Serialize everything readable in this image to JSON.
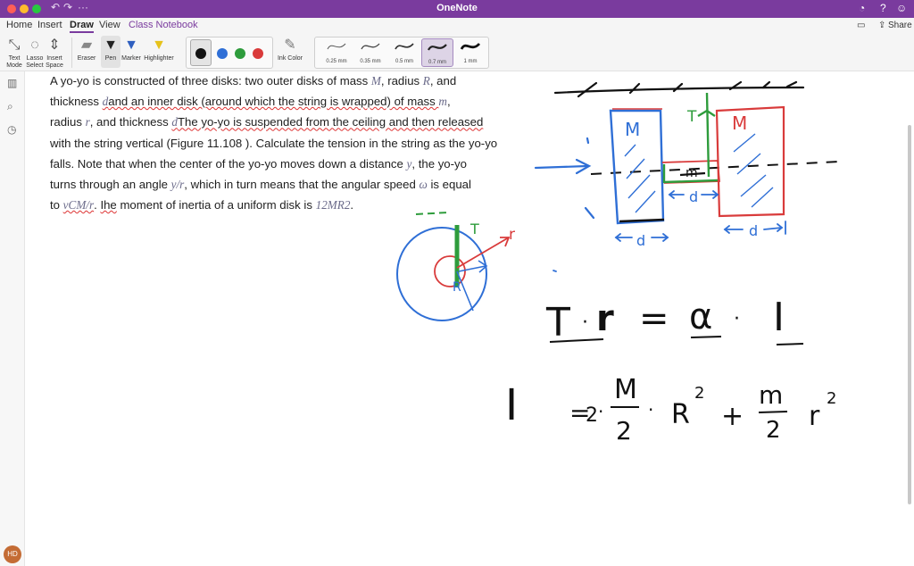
{
  "window": {
    "title": "OneNote"
  },
  "title_bar": {
    "share_label": "Share"
  },
  "menu": {
    "tabs": [
      "Home",
      "Insert",
      "Draw",
      "View",
      "Class Notebook"
    ],
    "active": "Draw"
  },
  "ribbon": {
    "tools": [
      {
        "label": "Text Mode",
        "icon": "text-mode-icon"
      },
      {
        "label": "Lasso Select",
        "icon": "lasso-icon"
      },
      {
        "label": "Insert Space",
        "icon": "insert-space-icon"
      },
      {
        "label": "Eraser",
        "icon": "eraser-icon"
      },
      {
        "label": "Pen",
        "icon": "pen-icon"
      },
      {
        "label": "Marker",
        "icon": "marker-icon"
      },
      {
        "label": "Highlighter",
        "icon": "highlighter-icon"
      }
    ],
    "ink_color_label": "Ink Color",
    "pen_colors": [
      "#111111",
      "#2f6fd6",
      "#2e9c3c",
      "#d93b3b"
    ],
    "sizes": [
      "0.25 mm",
      "0.35 mm",
      "0.5 mm",
      "0.7 mm",
      "1 mm"
    ],
    "selected_size": "0.7 mm"
  },
  "user": {
    "initials": "HD"
  },
  "problem": {
    "line1": {
      "a": "A yo-yo is constructed of three disks: two outer disks of mass ",
      "M": "M",
      "b": ", radius ",
      "R": "R",
      "c": ", and"
    },
    "line2": {
      "a": "thickness ",
      "d": "d",
      "b": "and an inner disk (around which the string is wrapped) of mass ",
      "m": "m",
      "c": ","
    },
    "line3": {
      "a": "radius ",
      "r": "r",
      "b": ", and thickness ",
      "d": "d",
      "c": "The yo-yo is suspended from the ceiling and then released"
    },
    "line4": "with the string vertical (Figure 11.108 ). Calculate the tension in the string as the yo-yo",
    "line5": {
      "a": "falls. Note that when the center of the yo-yo moves down a distance ",
      "y": "y",
      "b": ", the yo-yo"
    },
    "line6": {
      "a": "turns through an angle ",
      "yr": "y/r",
      "b": ", which in turn means that the angular speed ",
      "w": "ω",
      "c": " is equal"
    },
    "line7": {
      "a": "to ",
      "v": "vCM/r",
      "b": ". ",
      "the": "Ihe",
      "c": " moment of inertia of a uniform disk is ",
      "f": "12MR2",
      "d": "."
    }
  },
  "ink": {
    "side_labels": {
      "M_left": "M",
      "M_right": "M",
      "m_inner": "m",
      "T": "T",
      "d_left": "d",
      "d_middle": "d",
      "d_right": "d"
    },
    "circle_labels": {
      "T": "T",
      "r": "r",
      "R": "R"
    },
    "equation1": {
      "tau": "T",
      "dot": "·",
      "r": "r",
      "eq": "=",
      "alpha": "α",
      "dot2": "·",
      "I": "I"
    },
    "equation2": {
      "I": "I",
      "eq": "=",
      "two": "2",
      "dot": "·",
      "M": "M",
      "den1": "2",
      "dot2": "·",
      "R": "R",
      "sq1": "2",
      "plus": "+",
      "m": "m",
      "den2": "2",
      "r": "r",
      "sq2": "2"
    }
  }
}
